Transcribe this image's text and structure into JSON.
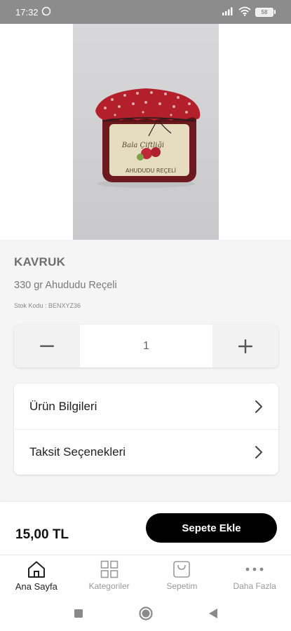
{
  "status": {
    "time": "17:32",
    "battery": "58"
  },
  "product": {
    "brand": "KAVRUK",
    "name": "330 gr Ahududu Reçeli",
    "stock_label": "Stok Kodu :",
    "stock_code": "BENXYZ36",
    "jar_brand_text": "Bala Çiftliği",
    "jar_label_text": "AHUDUDU REÇELİ"
  },
  "quantity": {
    "value": "1"
  },
  "details": [
    {
      "label": "Ürün Bilgileri"
    },
    {
      "label": "Taksit Seçenekleri"
    }
  ],
  "purchase": {
    "price": "15,00 TL",
    "button_label": "Sepete Ekle"
  },
  "tabs": [
    {
      "label": "Ana Sayfa",
      "icon": "home-icon",
      "active": true
    },
    {
      "label": "Kategoriler",
      "icon": "grid-icon",
      "active": false
    },
    {
      "label": "Sepetim",
      "icon": "bag-icon",
      "active": false
    },
    {
      "label": "Daha Fazla",
      "icon": "more-icon",
      "active": false
    }
  ],
  "colors": {
    "primary_button": "#000000",
    "status_bar": "#8c8c8c",
    "jam": "#7a1f22",
    "jar_cloth": "#b3202b"
  }
}
